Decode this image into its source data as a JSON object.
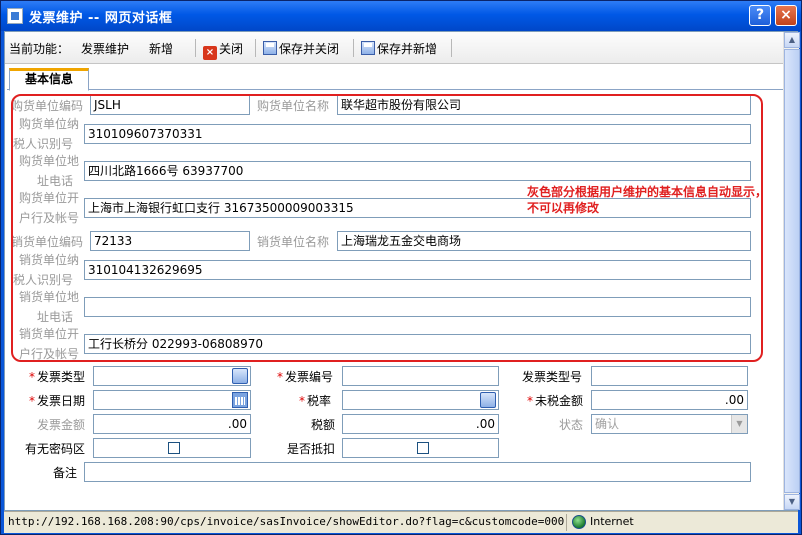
{
  "window": {
    "title": "发票维护 -- 网页对话框",
    "help": "?",
    "close": "×"
  },
  "toolbar": {
    "current_label": "当前功能：",
    "function": "发票维护",
    "mode": "新增",
    "close_label": "关闭",
    "save_close_label": "保存并关闭",
    "save_new_label": "保存并新增"
  },
  "tab": {
    "label": "基本信息"
  },
  "buyer": {
    "code_label": "购货单位编码",
    "code_value": "JSLH",
    "name_label": "购货单位名称",
    "name_value": "联华超市股份有限公司",
    "tax_label_1": "购货单位纳",
    "tax_label_2": "税人识别号",
    "tax_value": "310109607370331",
    "addr_label_1": "购货单位地",
    "addr_label_2": "址电话",
    "addr_value": "四川北路1666号 63937700",
    "bank_label_1": "购货单位开",
    "bank_label_2": "户行及帐号",
    "bank_value": "上海市上海银行虹口支行 31673500009003315"
  },
  "seller": {
    "code_label": "销货单位编码",
    "code_value": "72133",
    "name_label": "销货单位名称",
    "name_value": "上海瑞龙五金交电商场",
    "tax_label_1": "销货单位纳",
    "tax_label_2": "税人识别号",
    "tax_value": "310104132629695",
    "addr_label_1": "销货单位地",
    "addr_label_2": "址电话",
    "addr_value": "",
    "bank_label_1": "销货单位开",
    "bank_label_2": "户行及帐号",
    "bank_value": "工行长桥分 022993-06808970"
  },
  "note": "灰色部分根据用户维护的基本信息自动显示，不可以再修改",
  "invoice": {
    "type_label": "发票类型",
    "type_value": "",
    "number_label": "发票编号",
    "number_value": "",
    "model_label": "发票类型号",
    "model_value": "",
    "date_label": "发票日期",
    "date_value": "",
    "rate_label": "税率",
    "rate_value": "",
    "pretax_label": "未税金额",
    "pretax_value": ".00",
    "amount_label": "发票金额",
    "amount_value": ".00",
    "tax_label": "税额",
    "tax_value": ".00",
    "state_label": "状态",
    "state_value": "确认",
    "pwd_label": "有无密码区",
    "deduct_label": "是否抵扣",
    "remark_label": "备注",
    "remark_value": ""
  },
  "statusbar": {
    "url": "http://192.168.168.208:90/cps/invoice/sasInvoice/showEditor.do?flag=c&customcode=0001&o",
    "zone": "Internet"
  },
  "colors": {
    "title_bar": "#0058e6",
    "highlight": "#e02020",
    "required": "#d00000"
  }
}
